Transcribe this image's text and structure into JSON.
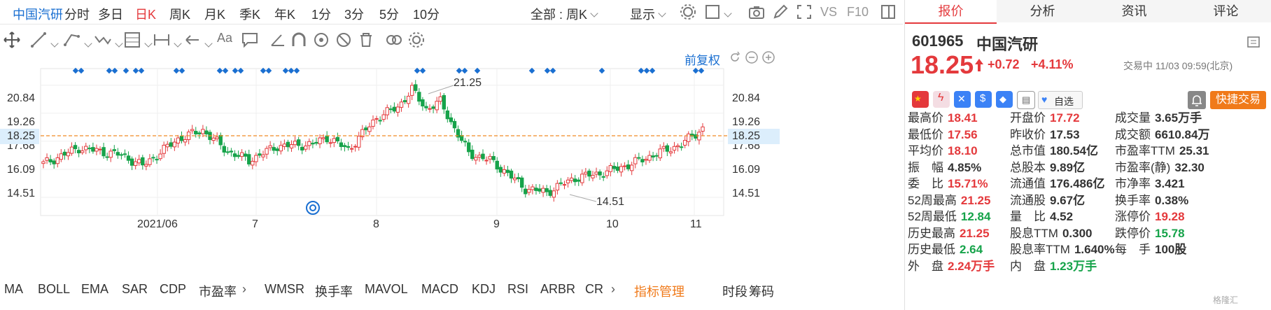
{
  "top_tabs": {
    "stock_name": "中国汽研",
    "periods": [
      "分时",
      "多日",
      "日K",
      "周K",
      "月K",
      "季K",
      "年K",
      "1分",
      "3分",
      "5分",
      "10分"
    ],
    "active_period": "日K",
    "all_select": "全部 : 周K",
    "display": "显示",
    "vs": "VS",
    "f10": "F10"
  },
  "chart_header": {
    "restore": "前复权"
  },
  "chart_data": {
    "type": "candlestick",
    "price_axis": [
      20.84,
      19.26,
      17.68,
      16.09,
      14.51
    ],
    "current_price_label": "18.25",
    "x_labels": [
      "2021/06",
      "7",
      "8",
      "9",
      "10",
      "11"
    ],
    "annotations": {
      "high": "21.25",
      "low": "14.51"
    },
    "colors": {
      "up": "#e4393c",
      "down": "#16a34a",
      "marker": "#1a6fd1",
      "price_line": "#f08a24"
    }
  },
  "indicators": {
    "items": [
      "MA",
      "BOLL",
      "EMA",
      "SAR",
      "CDP",
      "市盈率",
      "WMSR",
      "换手率",
      "MAVOL",
      "MACD",
      "KDJ",
      "RSI",
      "ARBR",
      "CR"
    ],
    "manage": "指标管理",
    "right_a": "时段",
    "right_b": "筹码"
  },
  "panel": {
    "tabs": [
      "报价",
      "分析",
      "资讯",
      "评论"
    ],
    "code": "601965",
    "name": "中国汽研",
    "price": "18.25",
    "change": "+0.72",
    "change_pct": "+4.11%",
    "status_time": "交易中 11/03 09:59(北京)",
    "watch_label": "自选",
    "trade_label": "快捷交易",
    "col1": [
      {
        "label": "最高价",
        "value": "18.41",
        "color": "red"
      },
      {
        "label": "最低价",
        "value": "17.56",
        "color": "red"
      },
      {
        "label": "平均价",
        "value": "18.10",
        "color": "red"
      },
      {
        "label": "振　幅",
        "value": "4.85%",
        "color": "blk"
      },
      {
        "label": "委　比",
        "value": "15.71%",
        "color": "red"
      },
      {
        "label": "52周最高",
        "value": "21.25",
        "color": "red"
      },
      {
        "label": "52周最低",
        "value": "12.84",
        "color": "green"
      },
      {
        "label": "历史最高",
        "value": "21.25",
        "color": "red"
      },
      {
        "label": "历史最低",
        "value": "2.64",
        "color": "green"
      },
      {
        "label": "外　盘",
        "value": "2.24万手",
        "color": "red"
      }
    ],
    "col2": [
      {
        "label": "开盘价",
        "value": "17.72",
        "color": "red"
      },
      {
        "label": "昨收价",
        "value": "17.53",
        "color": "blk"
      },
      {
        "label": "总市值",
        "value": "180.54亿",
        "color": "blk"
      },
      {
        "label": "总股本",
        "value": "9.89亿",
        "color": "blk"
      },
      {
        "label": "流通值",
        "value": "176.486亿",
        "color": "blk"
      },
      {
        "label": "流通股",
        "value": "9.67亿",
        "color": "blk"
      },
      {
        "label": "量　比",
        "value": "4.52",
        "color": "blk"
      },
      {
        "label": "股息TTM",
        "value": "0.300",
        "color": "blk"
      },
      {
        "label": "股息率TTM",
        "value": "1.640%",
        "color": "blk"
      },
      {
        "label": "内　盘",
        "value": "1.23万手",
        "color": "green"
      }
    ],
    "col3": [
      {
        "label": "成交量",
        "value": "3.65万手",
        "color": "blk"
      },
      {
        "label": "成交额",
        "value": "6610.84万",
        "color": "blk"
      },
      {
        "label": "市盈率TTM",
        "value": "25.31",
        "color": "blk"
      },
      {
        "label": "市盈率(静)",
        "value": "32.30",
        "color": "blk"
      },
      {
        "label": "市净率",
        "value": "3.421",
        "color": "blk"
      },
      {
        "label": "换手率",
        "value": "0.38%",
        "color": "blk"
      },
      {
        "label": "涨停价",
        "value": "19.28",
        "color": "red"
      },
      {
        "label": "跌停价",
        "value": "15.78",
        "color": "green"
      },
      {
        "label": "每　手",
        "value": "100股",
        "color": "blk"
      }
    ],
    "watermark": "格隆汇"
  }
}
